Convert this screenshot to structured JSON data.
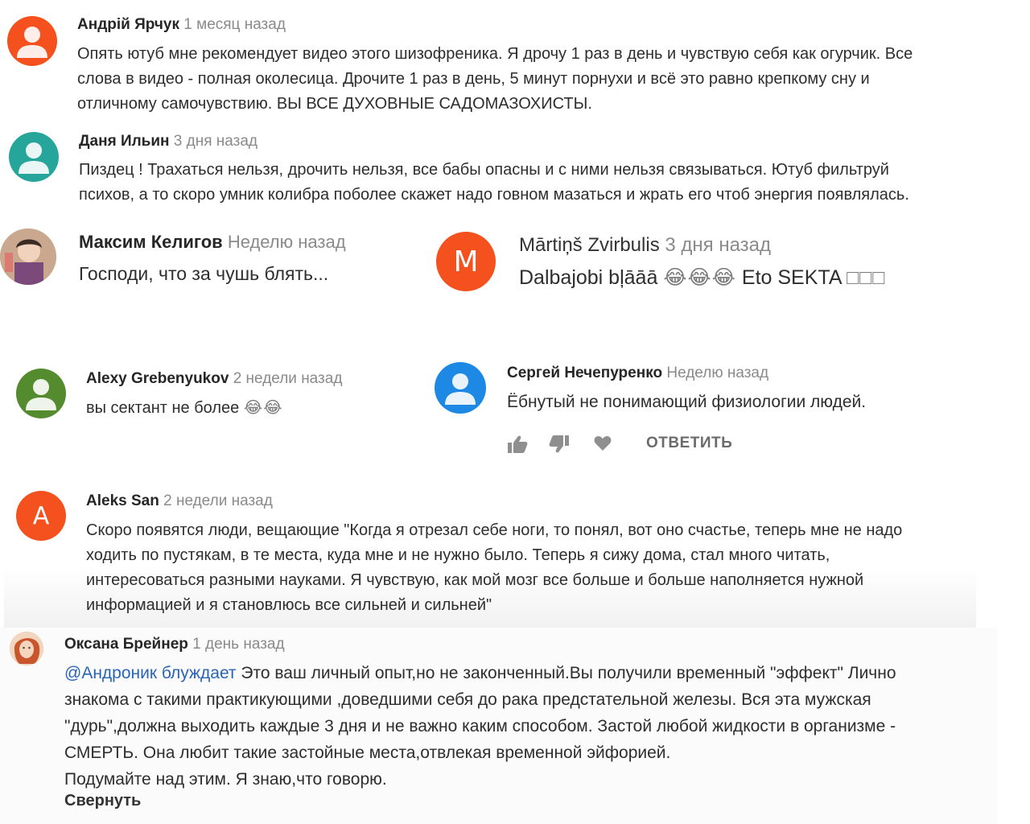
{
  "comments": [
    {
      "author": "Андрій Ярчук",
      "time": "1 месяц назад",
      "avatar_color": "#f4511e",
      "avatar_icon": "person-icon",
      "lines": [
        "Опять ютуб мне рекомендует видео этого шизофреника. Я дрочу 1 раз в день и чувствую себя как огурчик. Все",
        "слова в видео - полная околесица. Дрочите 1 раз в день, 5 минут порнухи и всё это равно крепкому сну и",
        "отличному самочувствию. ВЫ ВСЕ ДУХОВНЫЕ САДОМАЗОХИСТЫ."
      ]
    },
    {
      "author": "Даня Ильин",
      "time": "3 дня назад",
      "avatar_color": "#26a69a",
      "avatar_icon": "person-icon",
      "lines": [
        "Пиздец ! Трахаться нельзя, дрочить нельзя, все бабы опасны и с ними нельзя связываться. Ютуб фильтруй",
        "психов, а то скоро умник колибра поболее скажет надо говном мазаться и жрать его чтоб энергия появлялась."
      ]
    },
    {
      "author": "Максим Келигов",
      "time": "Неделю назад",
      "avatar_icon": "photo-avatar",
      "text": "Господи, что за чушь блять..."
    },
    {
      "author": "Mārtiņš Zvirbulis",
      "time": "3 дня назад",
      "avatar_color": "#f4511e",
      "avatar_letter": "M",
      "text": "Dalbajobi bļāāā",
      "emoji": "😂😂😂",
      "text2": "Eto SEKTA",
      "boxes": "□□□"
    },
    {
      "author": "Alexy Grebenyukov",
      "time": "2 недели назад",
      "avatar_color": "#558b2f",
      "avatar_icon": "person-icon",
      "text": "вы сектант не более",
      "emoji": "😂😂"
    },
    {
      "author": "Сергей Нечепуренко",
      "time": "Неделю назад",
      "avatar_color": "#1e88e5",
      "avatar_icon": "person-icon",
      "text": "Ёбнутый  не понимающий физиологии людей.",
      "actions": {
        "like_icon": "thumbs-up-icon",
        "dislike_icon": "thumbs-down-icon",
        "heart_icon": "heart-icon",
        "reply_label": "ОТВЕТИТЬ"
      }
    },
    {
      "author": "Aleks San",
      "time": "2 недели назад",
      "avatar_color": "#f4511e",
      "avatar_letter": "A",
      "lines": [
        "Скоро появятся люди, вещающие \"Когда я отрезал себе ноги, то понял, вот оно счастье, теперь мне не надо",
        "ходить по пустякам, в те места, куда мне и не нужно было. Теперь я сижу дома, стал много читать,",
        "интересоваться разными науками. Я чувствую, как мой мозг все больше и больше наполняется нужной",
        "информацией и я становлюсь все сильней и сильней\""
      ]
    },
    {
      "author": "Оксана Брейнер",
      "time": "1 день назад",
      "avatar_icon": "photo-avatar",
      "mention": "@Андроник блуждает",
      "line1_rest": " Это ваш личный опыт,но не законченный.Вы получили временный \"эффект\" Лично",
      "lines": [
        "знакома с такими практикующими ,доведшими себя до рака предстательной железы. Вся эта мужская",
        "\"дурь\",должна выходить каждые 3 дня и не важно каким способом. Застой любой жидкости в организме -",
        "СМЕРТЬ. Она любит такие застойные места,отвлекая временной эйфорией.",
        "Подумайте над этим. Я знаю,что говорю."
      ],
      "collapse_label": "Свернуть"
    }
  ]
}
